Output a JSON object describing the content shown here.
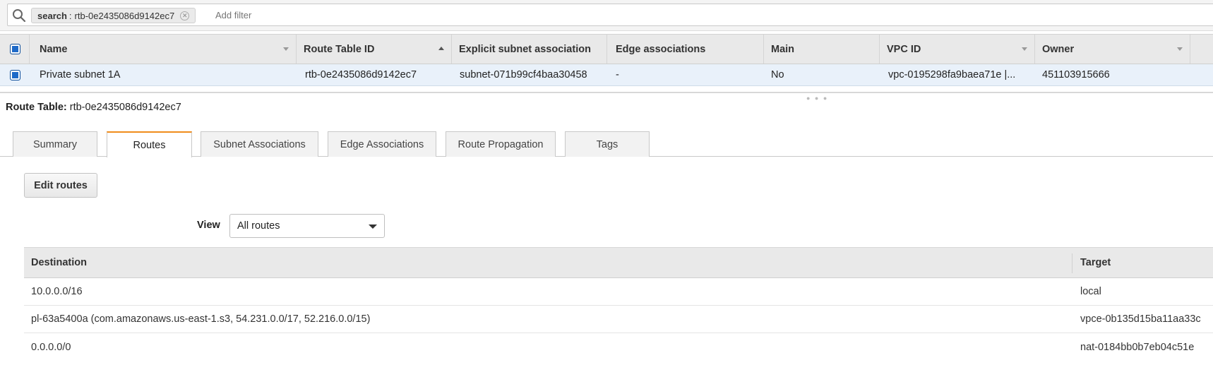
{
  "search": {
    "token_key": "search",
    "token_separator": ":",
    "token_value": "rtb-0e2435086d9142ec7",
    "placeholder": "Add filter"
  },
  "grid": {
    "columns": [
      "Name",
      "Route Table ID",
      "Explicit subnet association",
      "Edge associations",
      "Main",
      "VPC ID",
      "Owner"
    ],
    "row": {
      "name": "Private subnet 1A",
      "route_table_id": "rtb-0e2435086d9142ec7",
      "explicit_subnet": "subnet-071b99cf4baa30458",
      "edge": "-",
      "main": "No",
      "vpc_id": "vpc-0195298fa9baea71e |...",
      "owner": "451103915666"
    }
  },
  "detail": {
    "title_label": "Route Table:",
    "title_value": "rtb-0e2435086d9142ec7"
  },
  "tabs": [
    "Summary",
    "Routes",
    "Subnet Associations",
    "Edge Associations",
    "Route Propagation",
    "Tags"
  ],
  "active_tab": "Routes",
  "edit_routes_label": "Edit routes",
  "view": {
    "label": "View",
    "selected": "All routes"
  },
  "routes": {
    "headers": {
      "destination": "Destination",
      "target": "Target"
    },
    "rows": [
      {
        "destination": "10.0.0.0/16",
        "target": "local"
      },
      {
        "destination": "pl-63a5400a (com.amazonaws.us-east-1.s3, 54.231.0.0/17, 52.216.0.0/15)",
        "target": "vpce-0b135d15ba11aa33c"
      },
      {
        "destination": "0.0.0.0/0",
        "target": "nat-0184bb0b7eb04c51e"
      }
    ]
  },
  "colors": {
    "link": "#1d63b0",
    "active_tab_accent": "#f08c1b",
    "checkbox": "#1e6ac8"
  }
}
